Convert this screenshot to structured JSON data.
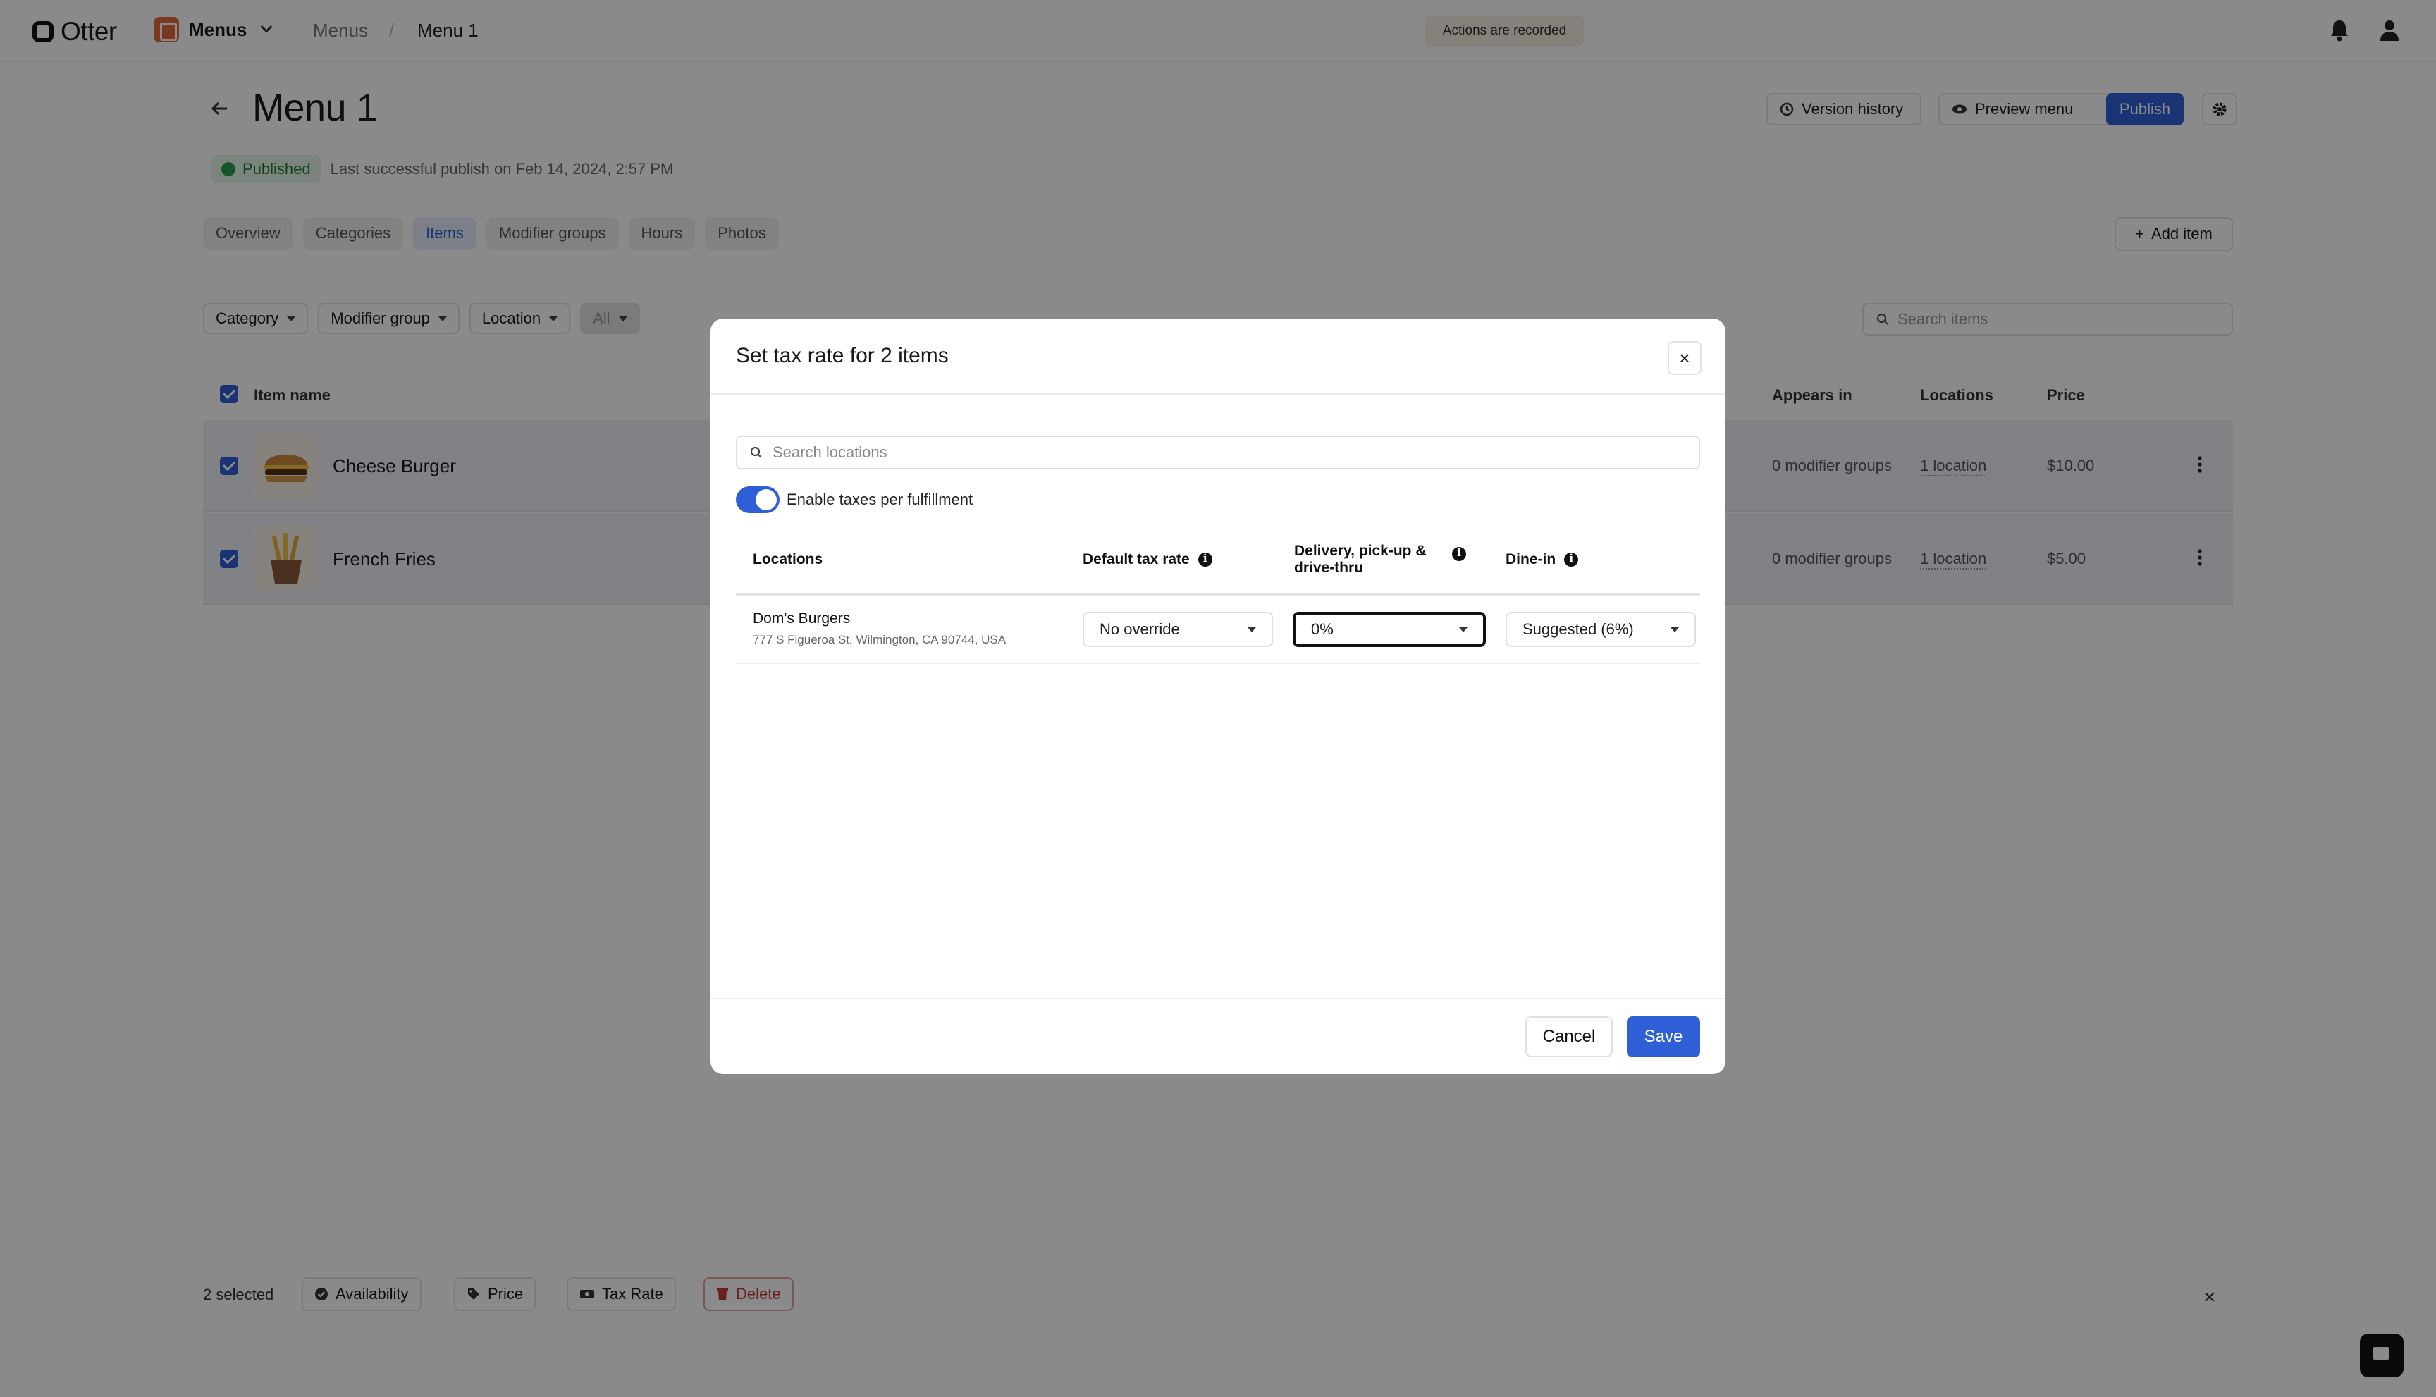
{
  "topbar": {
    "logo": "Otter",
    "app_name": "Menus",
    "breadcrumb": [
      "Menus",
      "/",
      "Menu 1"
    ],
    "recorded_badge": "Actions are recorded"
  },
  "page": {
    "title": "Menu 1",
    "buttons": {
      "version_history": "Version history",
      "preview_menu": "Preview menu",
      "publish": "Publish"
    },
    "status_badge": "Published",
    "last_publish": "Last successful publish on Feb 14, 2024, 2:57 PM",
    "tabs": [
      {
        "label": "Overview",
        "active": false
      },
      {
        "label": "Categories",
        "active": false
      },
      {
        "label": "Items",
        "active": true
      },
      {
        "label": "Modifier groups",
        "active": false
      },
      {
        "label": "Hours",
        "active": false
      },
      {
        "label": "Photos",
        "active": false
      }
    ],
    "add_item": "Add item",
    "filters": [
      "Category",
      "Modifier group",
      "Location",
      "All"
    ],
    "search_placeholder": "Search items"
  },
  "table": {
    "headers": {
      "name": "Item name",
      "appears_in": "Appears in",
      "locations": "Locations",
      "price": "Price"
    },
    "rows": [
      {
        "name": "Cheese Burger",
        "appears_in": "0 modifier groups",
        "locations": "1 location",
        "price": "$10.00",
        "selected": true
      },
      {
        "name": "French Fries",
        "appears_in": "0 modifier groups",
        "locations": "1 location",
        "price": "$5.00",
        "selected": true
      }
    ]
  },
  "bottom_bar": {
    "selected": "2 selected",
    "availability": "Availability",
    "price": "Price",
    "tax_rate": "Tax Rate",
    "delete": "Delete",
    "close": "×"
  },
  "modal": {
    "title": "Set tax rate for 2 items",
    "close": "×",
    "search_placeholder": "Search locations",
    "toggle_label": "Enable taxes per fulfillment",
    "toggle_on": true,
    "columns": {
      "locations": "Locations",
      "default_tax": "Default tax rate",
      "delivery": "Delivery, pick-up & drive-thru",
      "dine_in": "Dine-in"
    },
    "row": {
      "location_name": "Dom's Burgers",
      "address": "777 S Figueroa St, Wilmington, CA 90744, USA",
      "default_tax_value": "No override",
      "delivery_value": "0%",
      "dine_in_value": "Suggested (6%)"
    },
    "cancel": "Cancel",
    "save": "Save"
  },
  "colors": {
    "accent": "#2f5fd6",
    "published_green": "#2a9d4b",
    "delete_red": "#c23a3a"
  }
}
